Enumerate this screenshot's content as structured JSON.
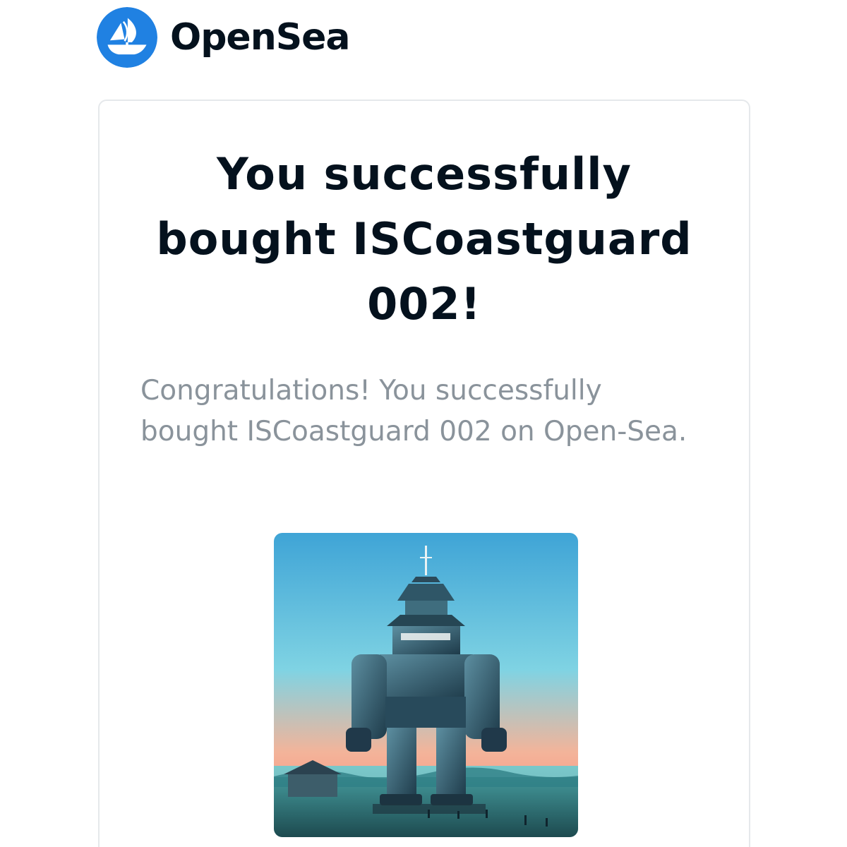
{
  "brand": {
    "name": "OpenSea",
    "logo_icon": "opensea-ship-logo-icon",
    "logo_color": "#2081e2"
  },
  "card": {
    "headline": "You successfully bought ISCoastguard 002!",
    "message": "Congratulations! You successfully bought ISCoastguard 002 on Open-Sea.",
    "nft_image_icon": "nft-artwork-giant-pagoda-robot"
  },
  "colors": {
    "headline": "#04111d",
    "message": "#8a939b",
    "card_border": "#e5e8eb"
  }
}
